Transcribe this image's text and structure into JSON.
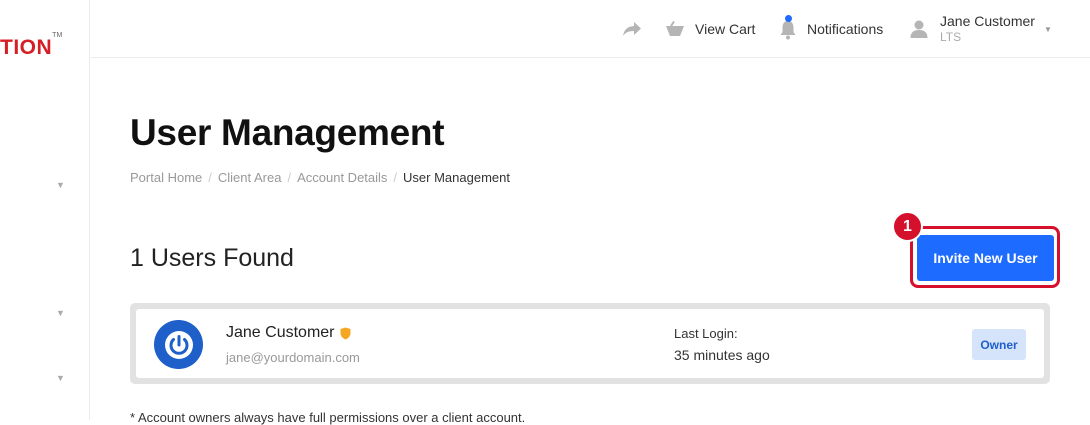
{
  "brand": {
    "logo_text": "TION",
    "logo_tm": "TM",
    "accent": "#d51f26"
  },
  "topbar": {
    "view_cart": "View Cart",
    "notifications": "Notifications",
    "user_name": "Jane Customer",
    "user_sub": "LTS"
  },
  "page": {
    "title": "User Management",
    "breadcrumb": [
      "Portal Home",
      "Client Area",
      "Account Details",
      "User Management"
    ],
    "users_found": "1 Users Found",
    "invite_button": "Invite New User",
    "step_badge": "1"
  },
  "users": [
    {
      "name": "Jane Customer",
      "email": "jane@yourdomain.com",
      "last_login_label": "Last Login:",
      "last_login_value": "35 minutes ago",
      "role": "Owner"
    }
  ],
  "footnote": "* Account owners always have full permissions over a client account.",
  "colors": {
    "primary": "#1e6bff",
    "highlight": "#d5102c",
    "avatar": "#1e5fc9",
    "owner_badge_bg": "#d6e4fb",
    "shield": "#f5a623"
  }
}
